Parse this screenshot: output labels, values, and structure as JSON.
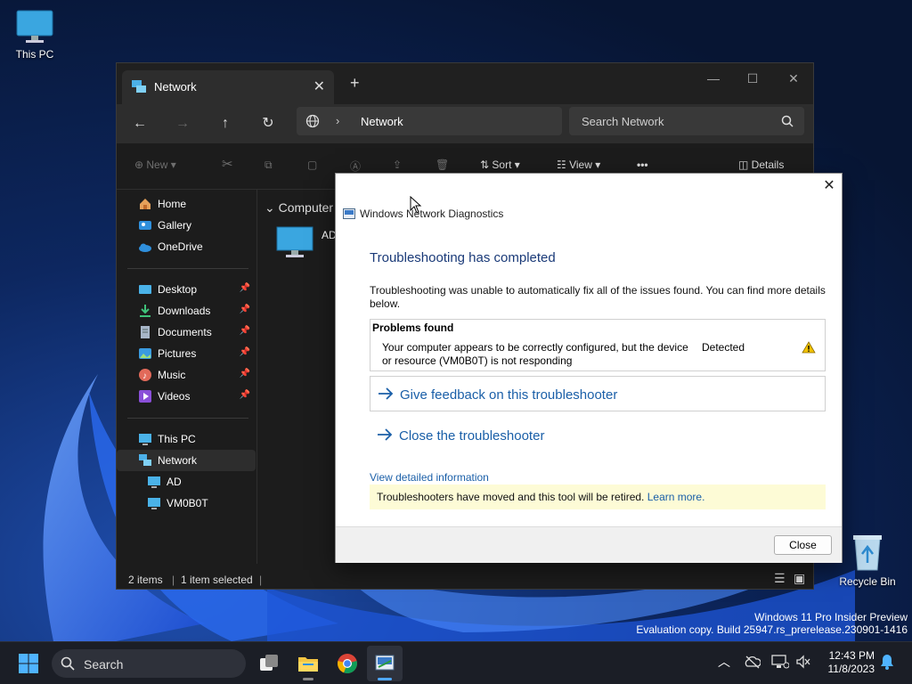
{
  "desktop": {
    "icons": [
      {
        "label": "This PC"
      },
      {
        "label": "Recycle Bin"
      }
    ]
  },
  "explorer": {
    "tab_title": "Network",
    "tab_close": "✕",
    "new_tab": "+",
    "window_controls": {
      "minimize": "—",
      "maximize": "☐",
      "close": "✕"
    },
    "address": {
      "location": "Network",
      "separator": "›"
    },
    "search_placeholder": "Search Network",
    "commands": {
      "new": "New",
      "sort": "Sort",
      "view": "View",
      "more": "•••",
      "details": "Details"
    },
    "sidebar": {
      "home": "Home",
      "gallery": "Gallery",
      "onedrive": "OneDrive",
      "desktop": "Desktop",
      "downloads": "Downloads",
      "documents": "Documents",
      "pictures": "Pictures",
      "music": "Music",
      "videos": "Videos",
      "this_pc": "This PC",
      "network": "Network",
      "ad": "AD",
      "vm": "VM0B0T",
      "pin": "📌"
    },
    "content": {
      "group_header": "Computer",
      "item_label": "AD"
    },
    "status": {
      "items": "2 items",
      "selected": "1 item selected"
    }
  },
  "dialog": {
    "title": "Windows Network Diagnostics",
    "close_x": "✕",
    "heading": "Troubleshooting has completed",
    "description": "Troubleshooting was unable to automatically fix all of the issues found. You can find more details below.",
    "problems_header": "Problems found",
    "problem_text": "Your computer appears to be correctly configured, but the device or resource (VM0B0T) is not responding",
    "problem_status": "Detected",
    "link_feedback": "Give feedback on this troubleshooter",
    "link_close": "Close the troubleshooter",
    "detailed_link": "View detailed information",
    "notice_text": "Troubleshooters have moved and this tool will be retired.",
    "notice_link": "Learn more.",
    "close_button": "Close"
  },
  "watermark": {
    "line1": "Windows 11 Pro Insider Preview",
    "line2": "Evaluation copy. Build 25947.rs_prerelease.230901-1416"
  },
  "taskbar": {
    "search_placeholder": "Search",
    "time": "12:43 PM",
    "date": "11/8/2023"
  },
  "colors": {
    "accent": "#1a5fa8",
    "heading": "#1a3a78",
    "notice_bg": "#fdfbd6",
    "taskbar": "#1b1e26"
  }
}
